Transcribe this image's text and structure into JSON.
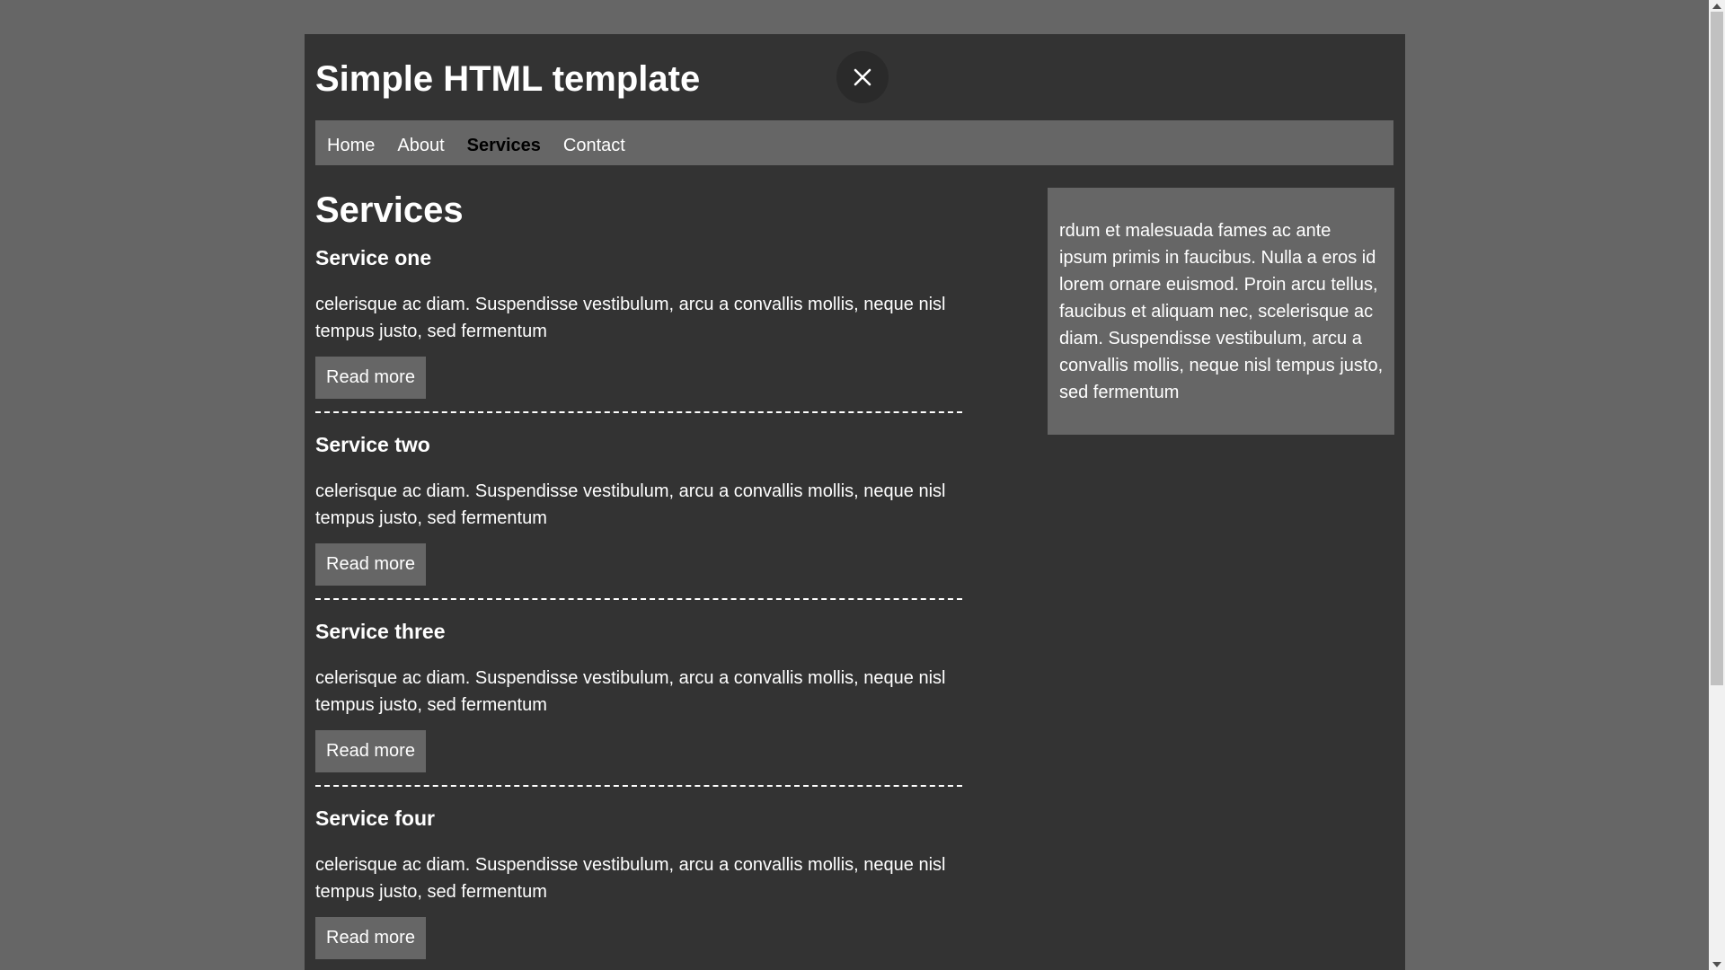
{
  "header": {
    "title": "Simple HTML template",
    "close_icon": "close-icon"
  },
  "nav": {
    "items": [
      {
        "label": "Home",
        "active": false
      },
      {
        "label": "About",
        "active": false
      },
      {
        "label": "Services",
        "active": true
      },
      {
        "label": "Contact",
        "active": false
      }
    ]
  },
  "main": {
    "heading": "Services",
    "services": [
      {
        "title": "Service one",
        "text": "celerisque ac diam. Suspendisse vestibulum, arcu a convallis mollis, neque nisl tempus justo, sed fermentum",
        "button": "Read more"
      },
      {
        "title": "Service two",
        "text": "celerisque ac diam. Suspendisse vestibulum, arcu a convallis mollis, neque nisl tempus justo, sed fermentum",
        "button": "Read more"
      },
      {
        "title": "Service three",
        "text": "celerisque ac diam. Suspendisse vestibulum, arcu a convallis mollis, neque nisl tempus justo, sed fermentum",
        "button": "Read more"
      },
      {
        "title": "Service four",
        "text": "celerisque ac diam. Suspendisse vestibulum, arcu a convallis mollis, neque nisl tempus justo, sed fermentum",
        "button": "Read more"
      }
    ]
  },
  "aside": {
    "text": "rdum et malesuada fames ac ante ipsum primis in faucibus. Nulla a eros id lorem ornare euismod. Proin arcu tellus, faucibus et aliquam nec, scelerisque ac diam. Suspendisse vestibulum, arcu a convallis mollis, neque nisl tempus justo, sed fermentum"
  },
  "colors": {
    "page_background": "#666666",
    "content_background": "#333333",
    "nav_background": "#666666",
    "button_background": "#666666",
    "text": "#ffffff",
    "active_nav_text": "#000000"
  }
}
